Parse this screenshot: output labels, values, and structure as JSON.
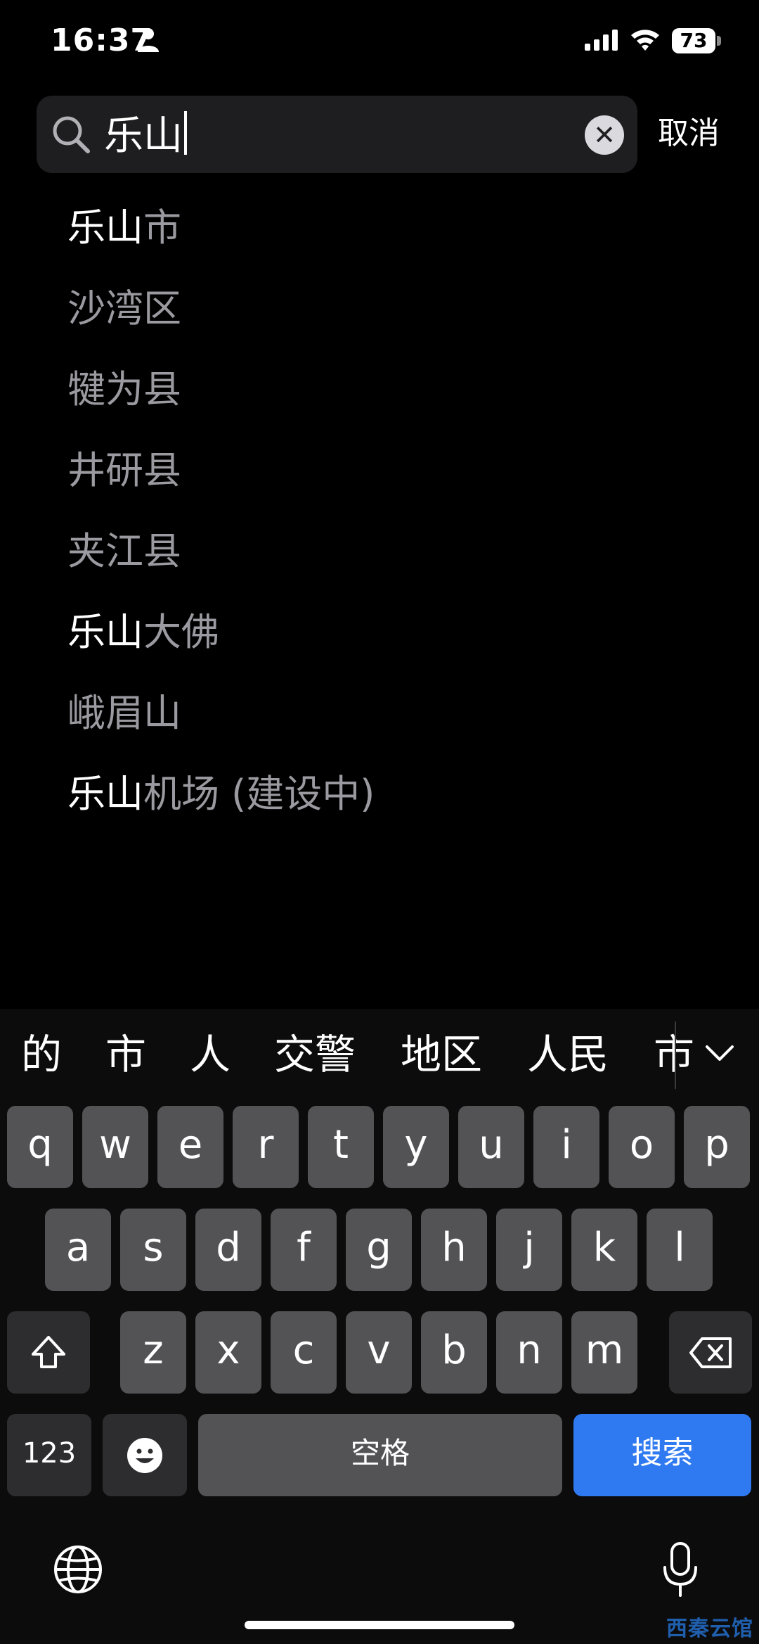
{
  "status_bar": {
    "time": "16:37",
    "battery": "73"
  },
  "search": {
    "query": "乐山",
    "cancel_label": "取消"
  },
  "results": [
    {
      "highlight": "乐山",
      "rest": "市"
    },
    {
      "highlight": "",
      "rest": "沙湾区"
    },
    {
      "highlight": "",
      "rest": "犍为县"
    },
    {
      "highlight": "",
      "rest": "井研县"
    },
    {
      "highlight": "",
      "rest": "夹江县"
    },
    {
      "highlight": "乐山",
      "rest": "大佛"
    },
    {
      "highlight": "",
      "rest": "峨眉山"
    },
    {
      "highlight": "乐山",
      "rest": "机场 (建设中)"
    }
  ],
  "keyboard": {
    "candidates": [
      "的",
      "市",
      "人",
      "交警",
      "地区",
      "人民",
      "市"
    ],
    "row1": [
      "q",
      "w",
      "e",
      "r",
      "t",
      "y",
      "u",
      "i",
      "o",
      "p"
    ],
    "row2": [
      "a",
      "s",
      "d",
      "f",
      "g",
      "h",
      "j",
      "k",
      "l"
    ],
    "row3": [
      "z",
      "x",
      "c",
      "v",
      "b",
      "n",
      "m"
    ],
    "numbers_label": "123",
    "space_label": "空格",
    "search_label": "搜索"
  },
  "watermark": "西秦云馆",
  "colors": {
    "accent": "#2f7af1",
    "background": "#000000",
    "key": "#535356"
  }
}
